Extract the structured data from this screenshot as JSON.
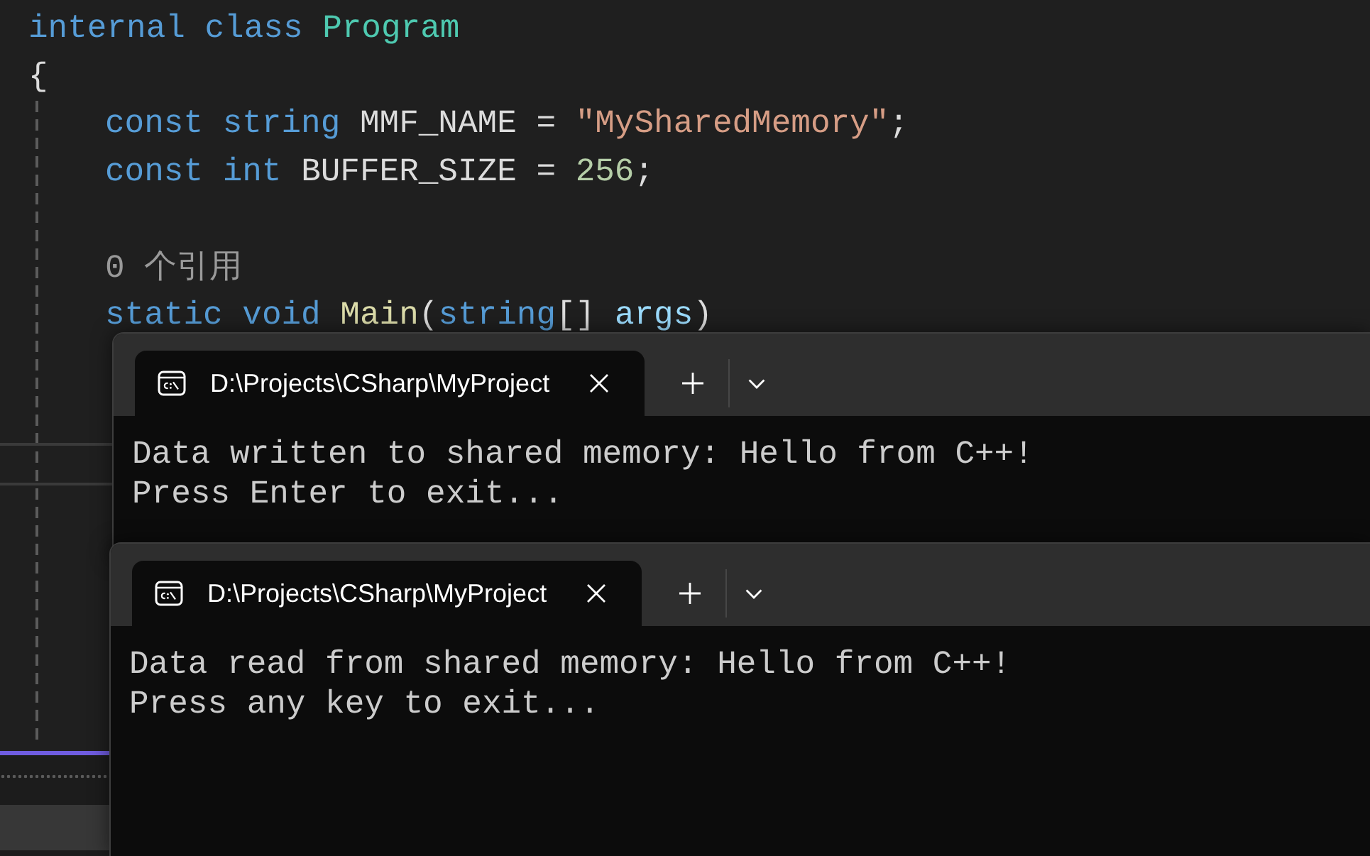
{
  "editor": {
    "lines": [
      {
        "kind": "code",
        "words": [
          [
            {
              "text": "internal",
              "kind": "keyword"
            }
          ],
          [
            {
              "text": "class",
              "kind": "keyword"
            }
          ],
          [
            {
              "text": "Program",
              "kind": "type"
            }
          ]
        ]
      },
      {
        "kind": "code",
        "words": [
          [
            {
              "text": "{",
              "kind": "plain"
            }
          ]
        ],
        "children": [
          {
            "kind": "code",
            "words": [
              [
                {
                  "text": "const",
                  "kind": "keyword"
                }
              ],
              [
                {
                  "text": "string",
                  "kind": "keyword"
                }
              ],
              [
                {
                  "text": "MMF_NAME",
                  "kind": "plain"
                }
              ],
              [
                {
                  "text": "=",
                  "kind": "plain"
                }
              ],
              [
                {
                  "text": "\"MySharedMemory\"",
                  "kind": "string"
                },
                {
                  "text": ";",
                  "kind": "plain"
                }
              ]
            ]
          },
          {
            "kind": "code",
            "words": [
              [
                {
                  "text": "const",
                  "kind": "keyword"
                }
              ],
              [
                {
                  "text": "int",
                  "kind": "keyword"
                }
              ],
              [
                {
                  "text": "BUFFER_SIZE",
                  "kind": "plain"
                }
              ],
              [
                {
                  "text": "=",
                  "kind": "plain"
                }
              ],
              [
                {
                  "text": "256",
                  "kind": "number"
                },
                {
                  "text": ";",
                  "kind": "plain"
                }
              ]
            ]
          },
          {
            "kind": "codelens",
            "text": "0 个引用"
          },
          {
            "kind": "code",
            "words": [
              [
                {
                  "text": "static",
                  "kind": "keyword"
                }
              ],
              [
                {
                  "text": "void",
                  "kind": "keyword"
                }
              ],
              [
                {
                  "text": "Main",
                  "kind": "method"
                },
                {
                  "text": "(",
                  "kind": "plain"
                },
                {
                  "text": "string",
                  "kind": "keyword"
                },
                {
                  "text": "[]",
                  "kind": "plain"
                }
              ],
              [
                {
                  "text": "args",
                  "kind": "parameter"
                },
                {
                  "text": ")",
                  "kind": "plain"
                }
              ]
            ]
          }
        ]
      }
    ]
  },
  "terminals": [
    {
      "tabs": [
        {
          "title": "D:\\Projects\\CSharp\\MyProject",
          "selected": true
        }
      ],
      "output": [
        "Data written to shared memory: Hello from C++!",
        "Press Enter to exit..."
      ]
    },
    {
      "tabs": [
        {
          "title": "D:\\Projects\\CSharp\\MyProject",
          "selected": true
        }
      ],
      "output": [
        "Data read from shared memory: Hello from C++!",
        "Press any key to exit..."
      ]
    }
  ]
}
